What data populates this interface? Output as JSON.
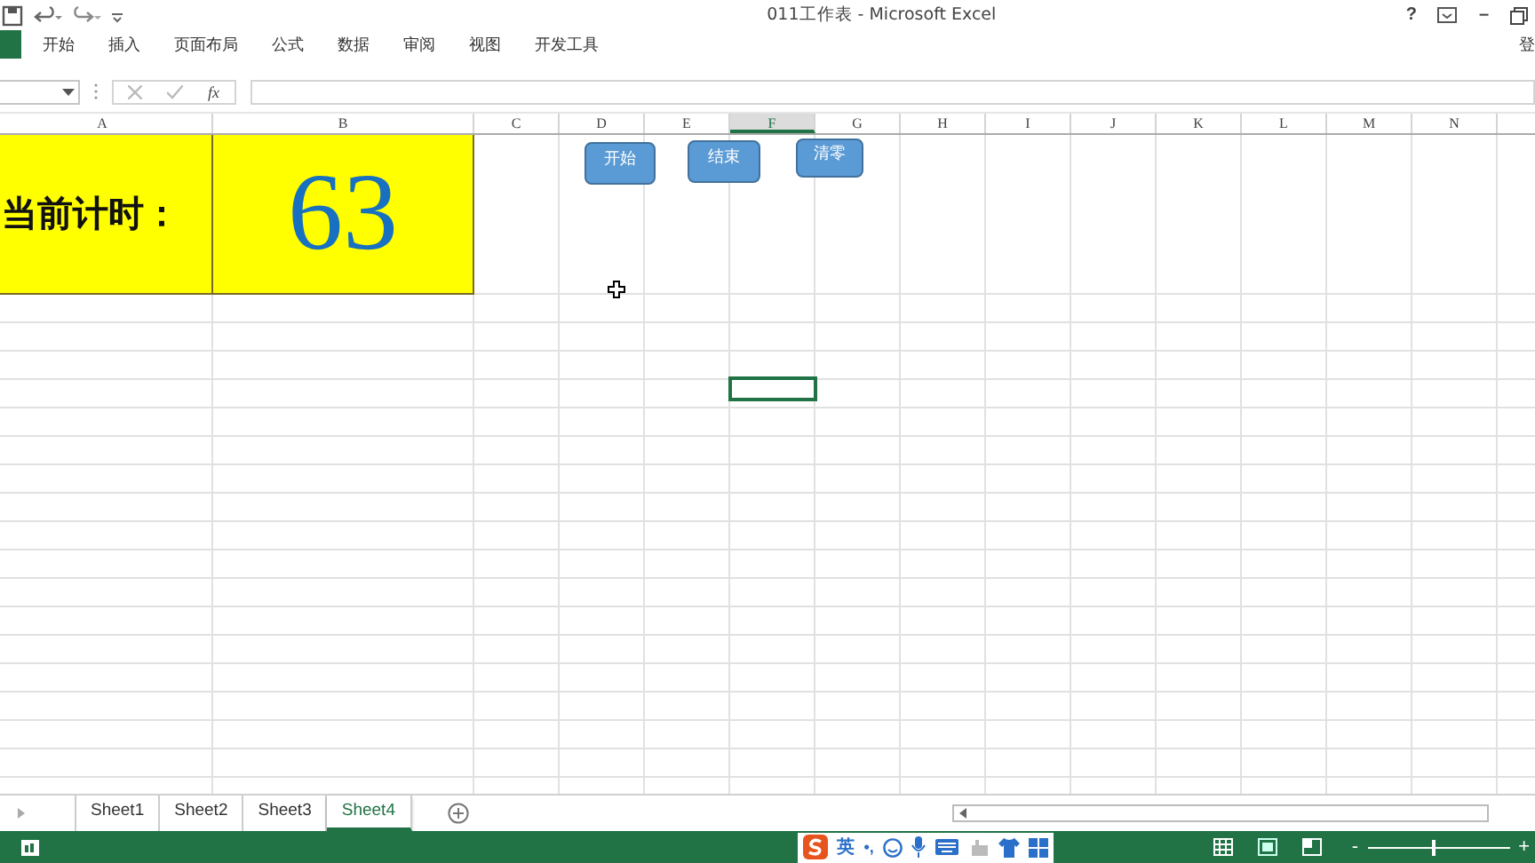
{
  "window": {
    "title": "011工作表 - Microsoft Excel",
    "help": "?",
    "minimize": "–",
    "login": "登"
  },
  "ribbon_tabs": [
    {
      "label": "开始"
    },
    {
      "label": "插入"
    },
    {
      "label": "页面布局"
    },
    {
      "label": "公式"
    },
    {
      "label": "数据"
    },
    {
      "label": "审阅"
    },
    {
      "label": "视图"
    },
    {
      "label": "开发工具"
    }
  ],
  "formula_bar": {
    "fx": "fx"
  },
  "columns": [
    {
      "label": "A",
      "selected": false
    },
    {
      "label": "B",
      "selected": false
    },
    {
      "label": "C",
      "selected": false
    },
    {
      "label": "D",
      "selected": false
    },
    {
      "label": "E",
      "selected": false
    },
    {
      "label": "F",
      "selected": true
    },
    {
      "label": "G",
      "selected": false
    },
    {
      "label": "H",
      "selected": false
    },
    {
      "label": "I",
      "selected": false
    },
    {
      "label": "J",
      "selected": false
    },
    {
      "label": "K",
      "selected": false
    },
    {
      "label": "L",
      "selected": false
    },
    {
      "label": "M",
      "selected": false
    },
    {
      "label": "N",
      "selected": false
    }
  ],
  "cells": {
    "label": "当前计时：",
    "value": "63"
  },
  "sheet_buttons": [
    {
      "label": "开始"
    },
    {
      "label": "结束"
    },
    {
      "label": "清零"
    }
  ],
  "sheet_tabs": [
    {
      "label": "Sheet1",
      "selected": false
    },
    {
      "label": "Sheet2",
      "selected": false
    },
    {
      "label": "Sheet3",
      "selected": false
    },
    {
      "label": "Sheet4",
      "selected": true
    }
  ],
  "status_bar": {
    "ime": "英",
    "ime_punct": "•,",
    "zoom_out": "-",
    "zoom_in": "+",
    "zoom_slider": {
      "level": 0.45
    }
  }
}
